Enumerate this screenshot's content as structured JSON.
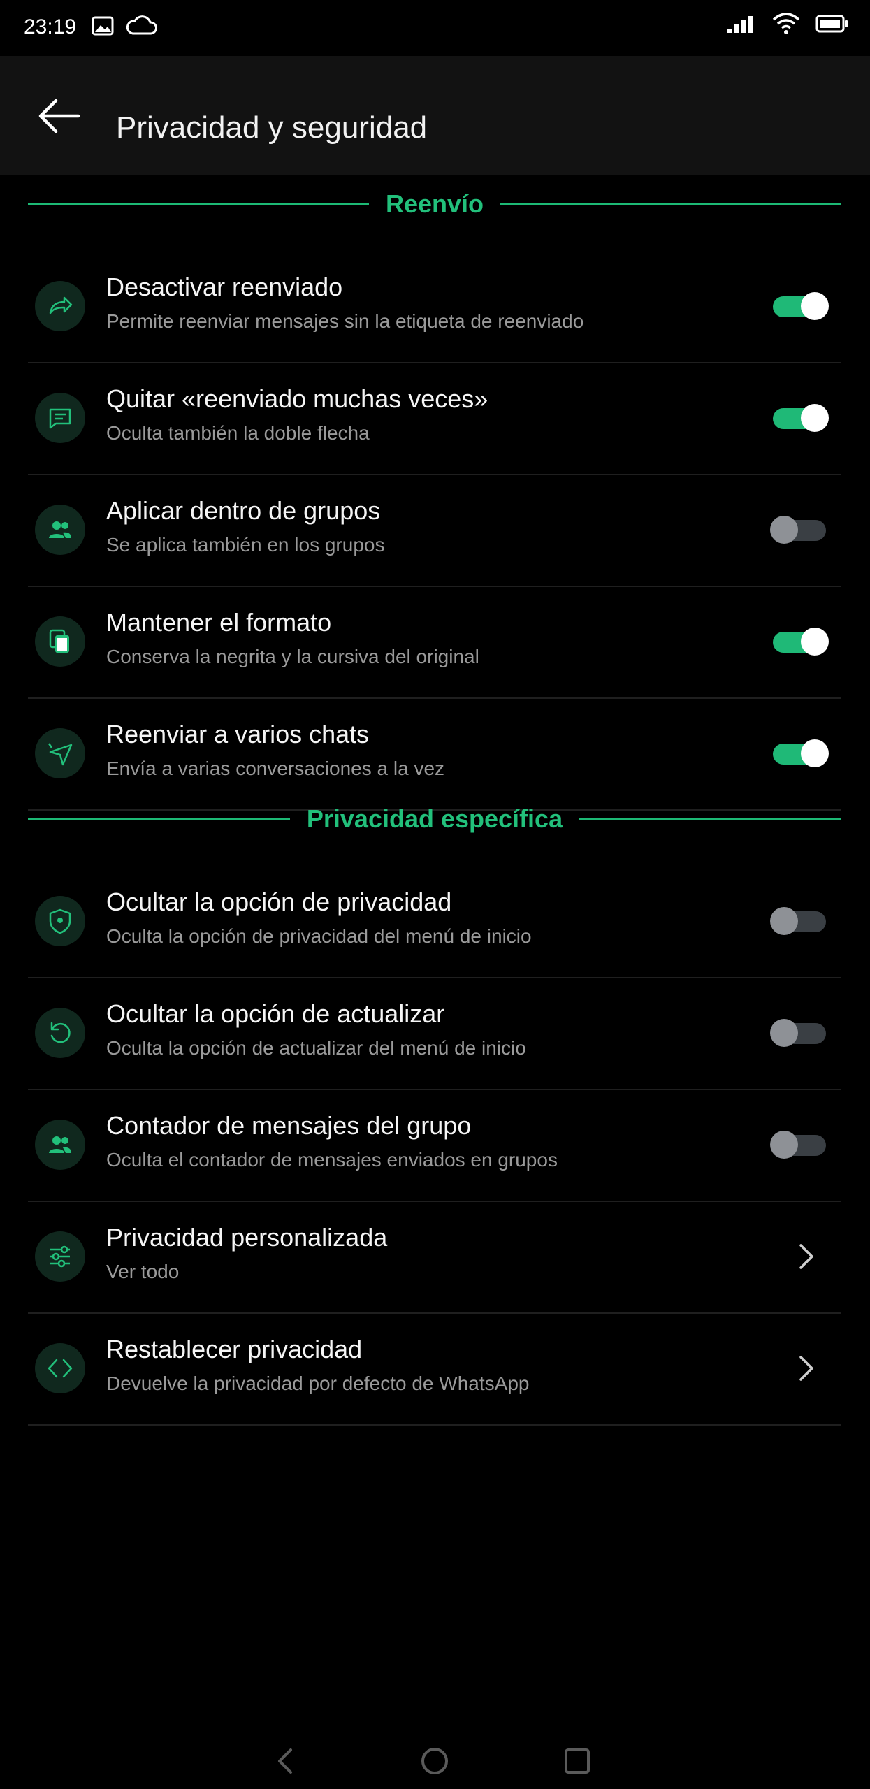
{
  "status_bar": {
    "time": "23:19",
    "left_icons": [
      "image-icon",
      "cloud-icon"
    ],
    "right_icons": [
      "signal-icon",
      "wifi-icon",
      "battery-icon"
    ]
  },
  "header": {
    "title": "Privacidad y seguridad",
    "back_icon": "arrow-left-icon"
  },
  "colors": {
    "accent": "#22c07b",
    "background": "#000000",
    "app_bar": "#121212",
    "subtitle": "#9a9a9a"
  },
  "sections": [
    {
      "title": "Reenvío",
      "items": [
        {
          "title": "Desactivar reenviado",
          "subtitle": "Permite reenviar mensajes sin la etiqueta de reenviado",
          "icon": "forward-icon",
          "control": "toggle",
          "on": true
        },
        {
          "title": "Quitar «reenviado muchas veces»",
          "subtitle": "Oculta también la doble flecha",
          "icon": "message-icon",
          "control": "toggle",
          "on": true
        },
        {
          "title": "Aplicar dentro de grupos",
          "subtitle": "Se aplica también en los grupos",
          "icon": "group-icon",
          "control": "toggle",
          "on": false
        },
        {
          "title": "Mantener el formato",
          "subtitle": "Conserva la negrita y la cursiva del original",
          "icon": "copy-icon",
          "control": "toggle",
          "on": true
        },
        {
          "title": "Reenviar a varios chats",
          "subtitle": "Envía a varias conversaciones a la vez",
          "icon": "send-icon",
          "control": "toggle",
          "on": true
        }
      ]
    },
    {
      "title": "Privacidad específica",
      "items": [
        {
          "title": "Ocultar la opción de privacidad",
          "subtitle": "Oculta la opción de privacidad del menú de inicio",
          "icon": "shield-icon",
          "control": "toggle",
          "on": false
        },
        {
          "title": "Ocultar la opción de actualizar",
          "subtitle": "Oculta la opción de actualizar del menú de inicio",
          "icon": "refresh-icon",
          "control": "toggle",
          "on": false
        },
        {
          "title": "Contador de mensajes del grupo",
          "subtitle": "Oculta el contador de mensajes enviados en grupos",
          "icon": "group-icon",
          "control": "toggle",
          "on": false
        },
        {
          "title": "Privacidad personalizada",
          "subtitle": "Ver todo",
          "icon": "sliders-icon",
          "control": "chevron"
        },
        {
          "title": "Restablecer privacidad",
          "subtitle": "Devuelve la privacidad por defecto de WhatsApp",
          "icon": "code-icon",
          "control": "chevron"
        }
      ]
    }
  ],
  "nav_bar": [
    "back-nav-icon",
    "home-nav-icon",
    "recents-nav-icon"
  ]
}
